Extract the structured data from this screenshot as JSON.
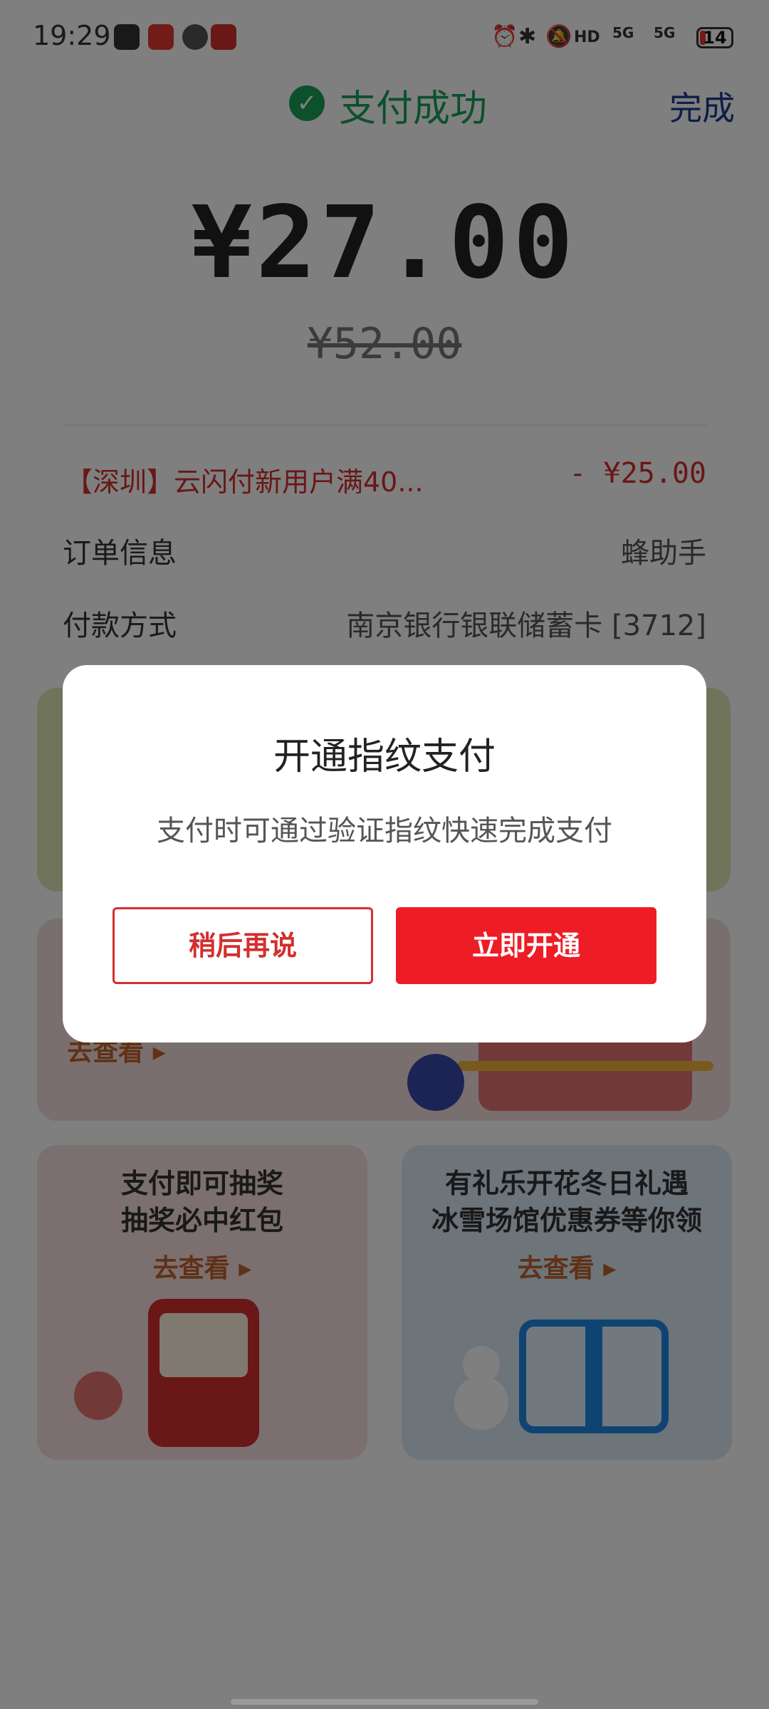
{
  "status_bar": {
    "time": "19:29",
    "network": "5G",
    "battery": "14",
    "battery_percent": 14
  },
  "header": {
    "title": "支付成功",
    "done_label": "完成"
  },
  "payment": {
    "amount": "¥27.00",
    "original_amount": "¥52.00"
  },
  "details": {
    "promo_label": "【深圳】云闪付新用户满40...",
    "promo_value": "- ¥25.00",
    "order_label": "订单信息",
    "order_value": "蜂助手",
    "method_label": "付款方式",
    "method_value": "南京银行银联储蓄卡 [3712]"
  },
  "cards": {
    "card2_link": "去查看",
    "card3_line1": "支付即可抽奖",
    "card3_line2": "抽奖必中红包",
    "card3_link": "去查看",
    "card4_line1": "有礼乐开花冬日礼遇",
    "card4_line2": "冰雪场馆优惠券等你领",
    "card4_link": "去查看"
  },
  "dialog": {
    "title": "开通指纹支付",
    "message": "支付时可通过验证指纹快速完成支付",
    "later_label": "稍后再说",
    "open_label": "立即开通"
  },
  "colors": {
    "success_green": "#18a058",
    "brand_red": "#ee1c25",
    "link_blue": "#1a3c8f"
  }
}
